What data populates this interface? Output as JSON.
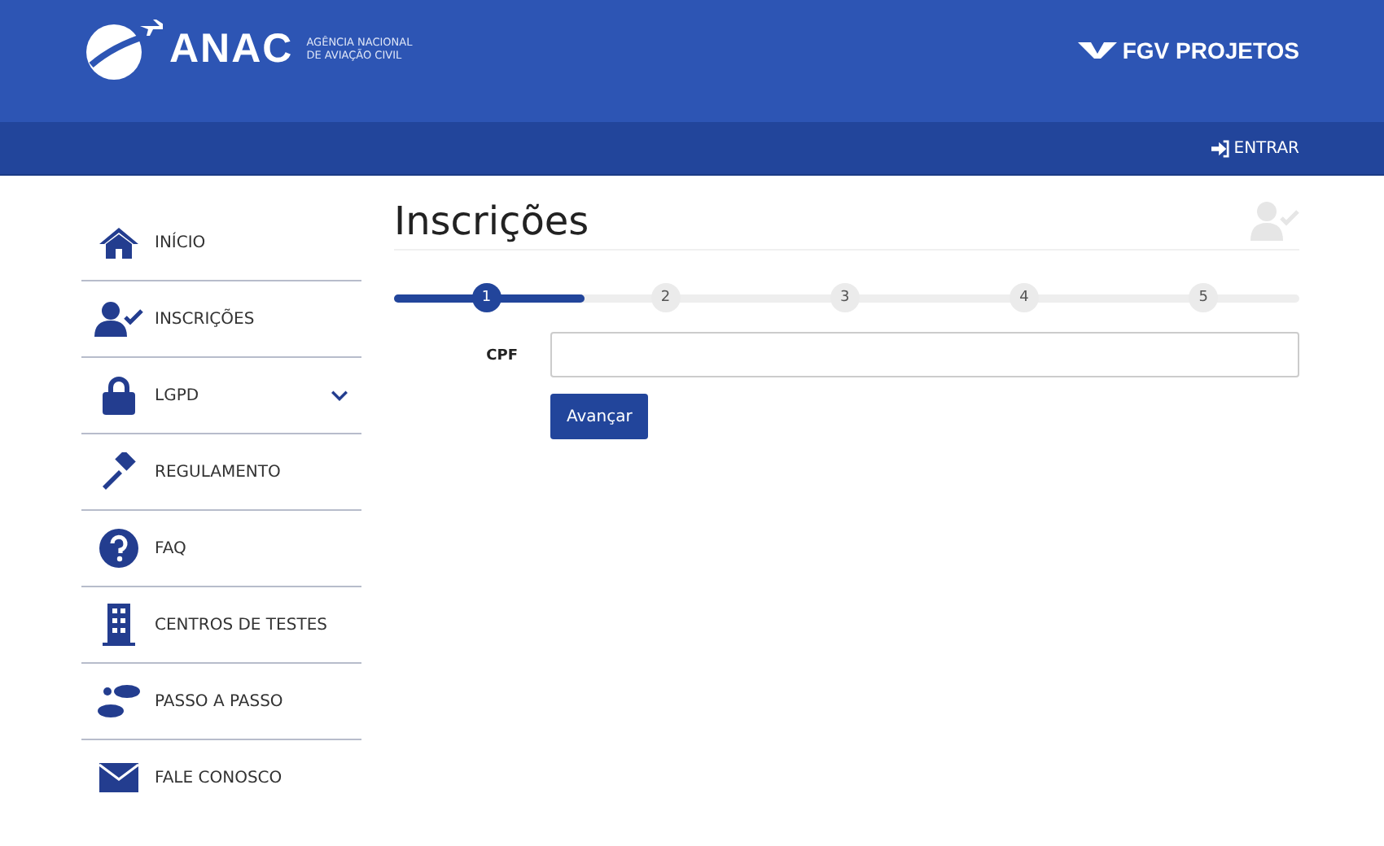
{
  "header": {
    "logo_text": "ANAC",
    "logo_subtitle_1": "AGÊNCIA NACIONAL",
    "logo_subtitle_2": "DE AVIAÇÃO CIVIL",
    "partner": "FGV PROJETOS"
  },
  "nav_bar": {
    "login": "ENTRAR"
  },
  "sidebar": {
    "items": [
      {
        "label": "INÍCIO",
        "has_submenu": false
      },
      {
        "label": "INSCRIÇÕES",
        "has_submenu": false
      },
      {
        "label": "LGPD",
        "has_submenu": true
      },
      {
        "label": "REGULAMENTO",
        "has_submenu": false
      },
      {
        "label": "FAQ",
        "has_submenu": false
      },
      {
        "label": "CENTROS DE TESTES",
        "has_submenu": false
      },
      {
        "label": "PASSO A PASSO",
        "has_submenu": false
      },
      {
        "label": "FALE CONOSCO",
        "has_submenu": false
      }
    ]
  },
  "page": {
    "title": "Inscrições",
    "progress": {
      "level": 0.21,
      "steps": [
        {
          "label": "1",
          "selected": true
        },
        {
          "label": "2",
          "selected": false
        },
        {
          "label": "3",
          "selected": false
        },
        {
          "label": "4",
          "selected": false
        },
        {
          "label": "5",
          "selected": false
        }
      ]
    },
    "form": {
      "field_label": "CPF",
      "button": "Avançar"
    }
  }
}
